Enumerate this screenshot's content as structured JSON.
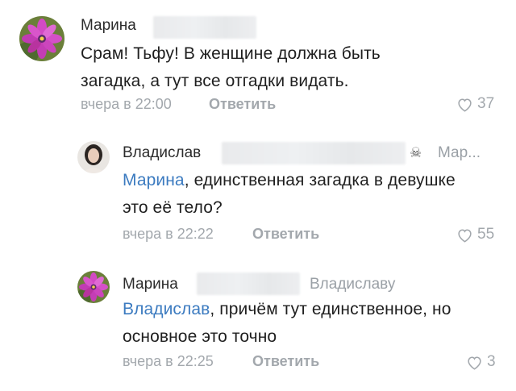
{
  "comments": [
    {
      "author": "Марина",
      "text": "Срам! Тьфу! В женщине должна быть загадка, а тут все отгадки видать.",
      "time": "вчера в 22:00",
      "reply_label": "Ответить",
      "likes": "37"
    },
    {
      "author": "Владислав",
      "reply_to": "Мар...",
      "mention": "Марина",
      "text_rest": ", единственная загадка в девушке это её тело?",
      "time": "вчера в 22:22",
      "reply_label": "Ответить",
      "likes": "55"
    },
    {
      "author": "Марина",
      "reply_to": "Владиславу",
      "mention": "Владислав",
      "text_rest": ", причём тут единственное, но основное это точно",
      "time": "вчера в 22:25",
      "reply_label": "Ответить",
      "likes": "3"
    }
  ],
  "colors": {
    "link": "#3c7bc0",
    "muted": "#a3a8ad",
    "avatar_flower": "#c43db5"
  },
  "icons": [
    "heart-outline-icon",
    "skull-icon"
  ]
}
